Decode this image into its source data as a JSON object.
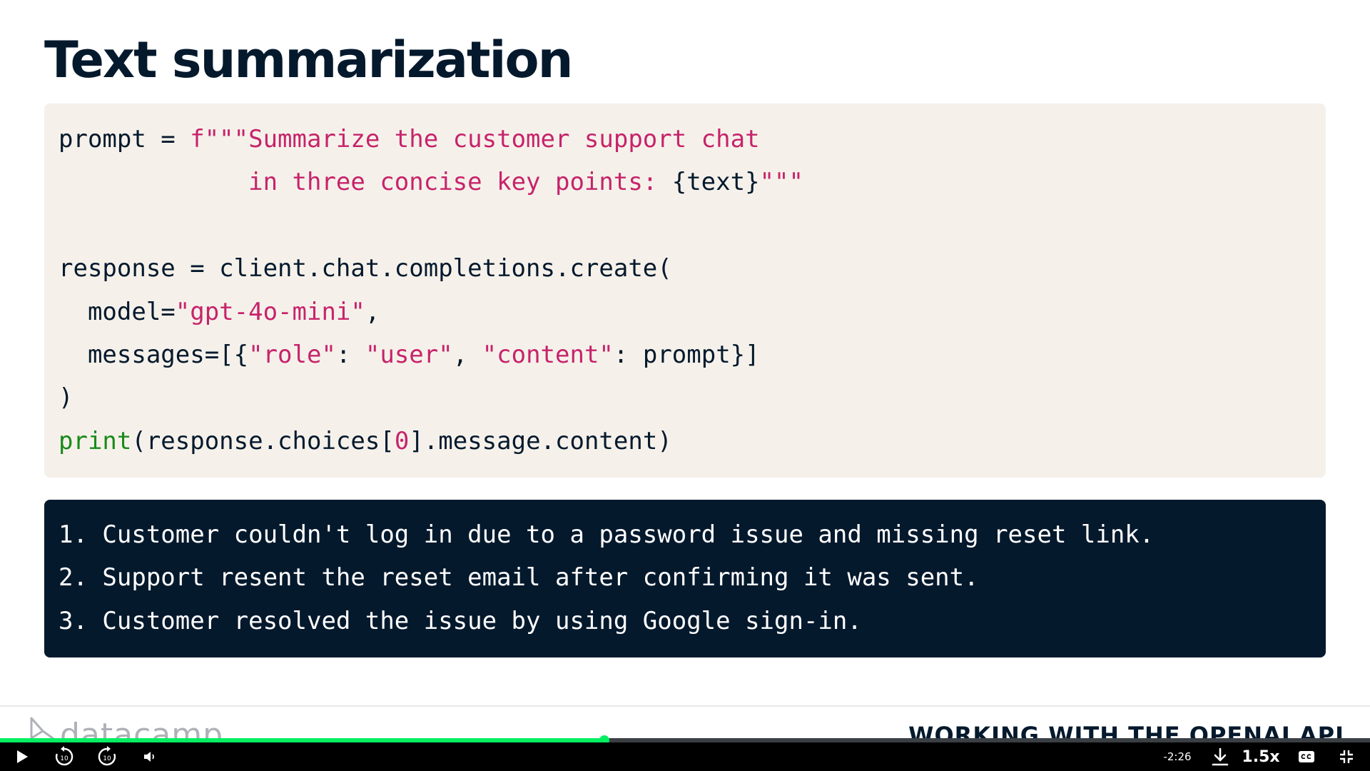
{
  "slide": {
    "title": "Text summarization"
  },
  "code": {
    "lines": [
      [
        {
          "t": "prompt = ",
          "c": "plain"
        },
        {
          "t": "f\"\"\"Summarize the customer support chat",
          "c": "str"
        }
      ],
      [
        {
          "t": "             ",
          "c": "plain"
        },
        {
          "t": "in three concise key points: ",
          "c": "str"
        },
        {
          "t": "{text}",
          "c": "plain"
        },
        {
          "t": "\"\"\"",
          "c": "str"
        }
      ],
      [],
      [
        {
          "t": "response = client.chat.completions.create(",
          "c": "plain"
        }
      ],
      [
        {
          "t": "  model=",
          "c": "plain"
        },
        {
          "t": "\"gpt-4o-mini\"",
          "c": "str"
        },
        {
          "t": ",",
          "c": "plain"
        }
      ],
      [
        {
          "t": "  messages=[{",
          "c": "plain"
        },
        {
          "t": "\"role\"",
          "c": "str"
        },
        {
          "t": ": ",
          "c": "plain"
        },
        {
          "t": "\"user\"",
          "c": "str"
        },
        {
          "t": ", ",
          "c": "plain"
        },
        {
          "t": "\"content\"",
          "c": "str"
        },
        {
          "t": ": prompt}]",
          "c": "plain"
        }
      ],
      [
        {
          "t": ")",
          "c": "plain"
        }
      ],
      [
        {
          "t": "print",
          "c": "kw"
        },
        {
          "t": "(response.choices[",
          "c": "plain"
        },
        {
          "t": "0",
          "c": "str"
        },
        {
          "t": "].message.content)",
          "c": "plain"
        }
      ]
    ]
  },
  "output": {
    "lines": [
      "1. Customer couldn't log in due to a password issue and missing reset link.",
      "2. Support resent the reset email after confirming it was sent.",
      "3. Customer resolved the issue by using Google sign-in."
    ]
  },
  "footer": {
    "logo_text": "datacamp",
    "course_title": "WORKING WITH THE OPENAI API"
  },
  "player": {
    "progress_fraction": 0.441,
    "time_remaining": "-2:26",
    "speed": "1.5x",
    "rewind_seconds": "10",
    "forward_seconds": "10",
    "icons": {
      "play": "play-icon",
      "rewind": "rewind-10-icon",
      "forward": "forward-10-icon",
      "volume": "volume-icon",
      "download": "download-icon",
      "captions": "captions-icon",
      "exit_fullscreen": "exit-fullscreen-icon"
    }
  },
  "colors": {
    "code_bg": "#f5f1ea",
    "output_bg": "#05192d",
    "string": "#c7236b",
    "builtin": "#1a8a1a",
    "progress": "#03ef62"
  }
}
